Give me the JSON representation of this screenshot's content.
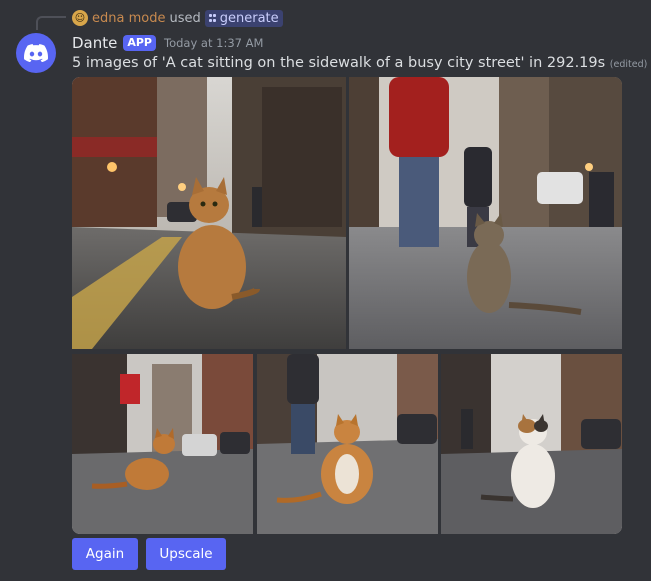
{
  "reply": {
    "user": "edna mode",
    "used_text": "used",
    "command": "generate"
  },
  "message": {
    "author": "Dante",
    "badge": "APP",
    "timestamp": "Today at 1:37 AM",
    "text": "5 images of 'A cat sitting on the sidewalk of a busy city street' in 292.19s",
    "edited": "(edited)"
  },
  "images": [
    {
      "id": "image-1",
      "cat": "orange tabby"
    },
    {
      "id": "image-2",
      "cat": "brown tabby"
    },
    {
      "id": "image-3",
      "cat": "orange tabby"
    },
    {
      "id": "image-4",
      "cat": "orange and white"
    },
    {
      "id": "image-5",
      "cat": "calico"
    }
  ],
  "buttons": {
    "again": "Again",
    "upscale": "Upscale"
  },
  "colors": {
    "background": "#313338",
    "blurple": "#5865f2",
    "reply_user": "#c88a4f"
  }
}
